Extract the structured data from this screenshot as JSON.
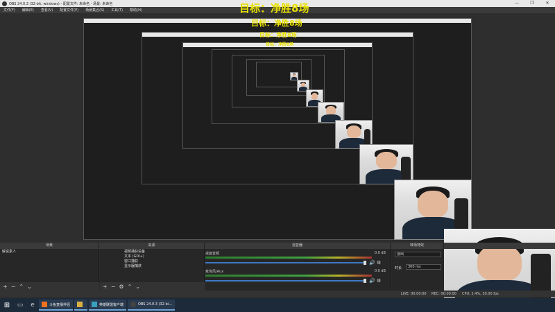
{
  "window": {
    "title": "OBS 24.0.3 (32-bit, windows) - 配置文件: 未命名 - 场景: 未命名",
    "controls": [
      "—",
      "❐",
      "✕"
    ]
  },
  "menu": [
    "文件(F)",
    "编辑(E)",
    "查看(V)",
    "配置文件(P)",
    "场景集合(S)",
    "工具(T)",
    "帮助(H)"
  ],
  "overlay": {
    "goal_text": "目标：净胜8场"
  },
  "docks": {
    "scenes_title": "场景",
    "sources_title": "来源",
    "mixer_title": "混音器",
    "transitions_title": "转场特效"
  },
  "scenes": [
    {
      "name": "解说素人"
    }
  ],
  "sources": [
    {
      "name": "视频捕获设备"
    },
    {
      "name": "文本 (GDI+)"
    },
    {
      "name": "窗口捕获"
    },
    {
      "name": "显示器捕获"
    }
  ],
  "mixer": [
    {
      "name": "桌面音频",
      "db": "0.0 dB"
    },
    {
      "name": "麦克风/Aux",
      "db": "0.0 dB"
    }
  ],
  "transitions": {
    "selected": "淡出",
    "duration_label": "时长",
    "duration_value": "300 ms"
  },
  "status": {
    "live": "LIVE: 00:00:00",
    "rec": "REC: 00:00:00",
    "cpu": "CPU: 2.4%, 30.00 fps"
  },
  "taskbar": {
    "apps": [
      {
        "label": "斗鱼直播伴侣",
        "color": "#f07020"
      },
      {
        "label": "",
        "color": "#d8b040"
      },
      {
        "label": "英雄联盟客户端",
        "color": "#3aa0c0"
      },
      {
        "label": "OBS 24.0.3 (32-bi...",
        "color": "#444"
      }
    ]
  },
  "tools": {
    "add": "+",
    "remove": "−",
    "up": "⌃",
    "down": "⌄",
    "settings": "⚙"
  }
}
